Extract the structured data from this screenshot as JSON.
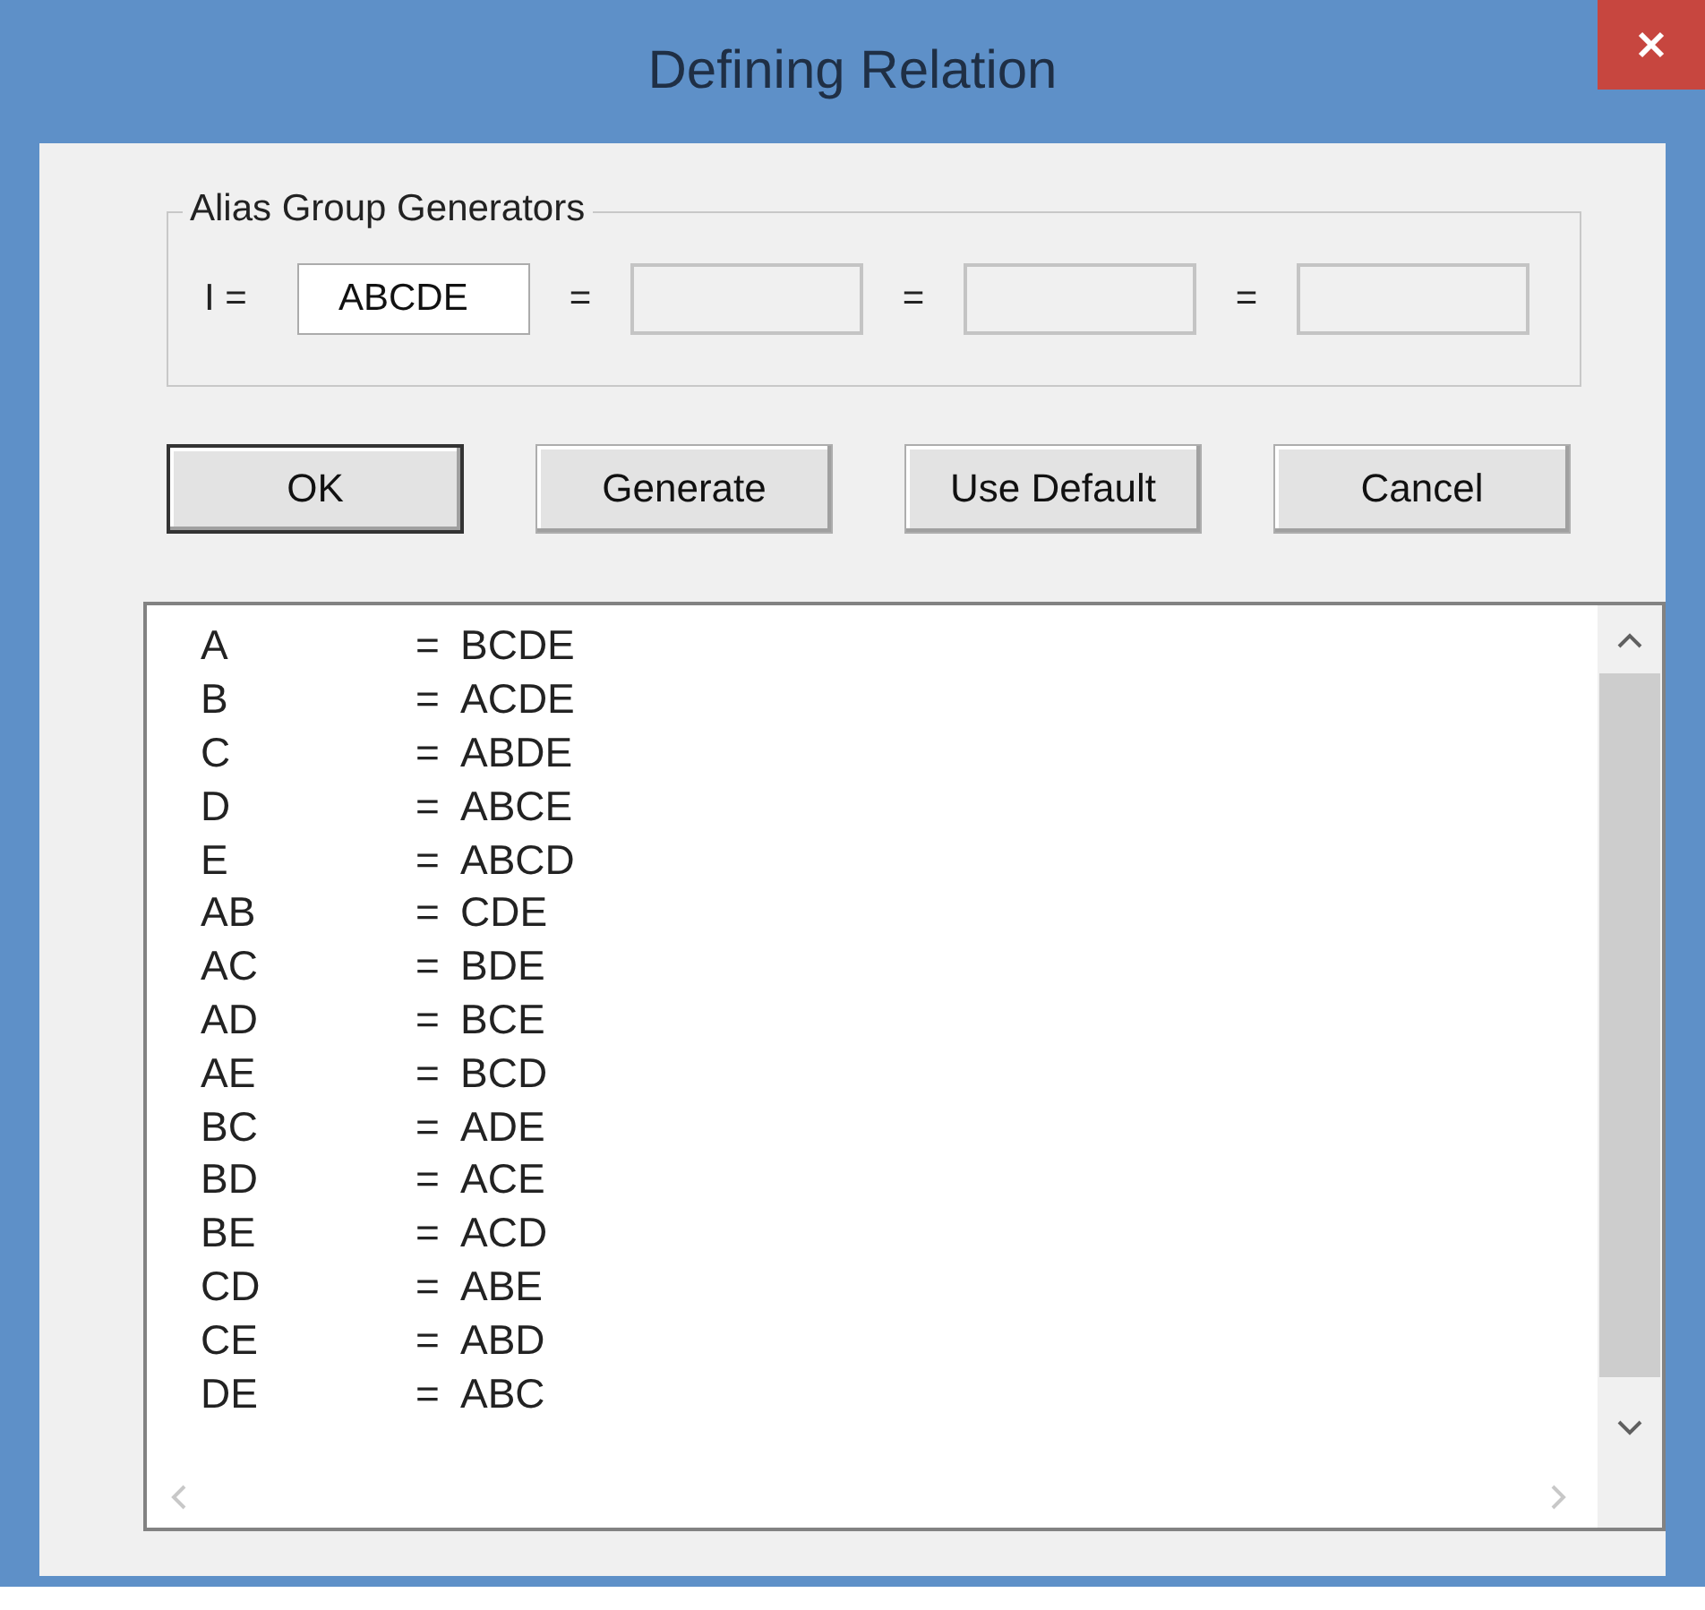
{
  "window": {
    "title": "Defining Relation"
  },
  "group": {
    "label": "Alias Group Generators",
    "fields": [
      {
        "prefix": "I =",
        "value": "ABCDE",
        "disabled": false
      },
      {
        "prefix": "=",
        "disabled": true
      },
      {
        "prefix": "=",
        "disabled": true
      },
      {
        "prefix": "=",
        "disabled": true
      }
    ]
  },
  "buttons": [
    {
      "label": "OK",
      "default": true
    },
    {
      "label": "Generate",
      "default": false
    },
    {
      "label": "Use Default",
      "default": false
    },
    {
      "label": "Cancel",
      "default": false
    }
  ],
  "list": {
    "rows": [
      {
        "term": "A",
        "eq": "=",
        "alias": "BCDE"
      },
      {
        "term": "B",
        "eq": "=",
        "alias": "ACDE"
      },
      {
        "term": "C",
        "eq": "=",
        "alias": "ABDE"
      },
      {
        "term": "D",
        "eq": "=",
        "alias": "ABCE"
      },
      {
        "term": "E",
        "eq": "=",
        "alias": "ABCD"
      },
      {
        "term": "AB",
        "eq": "=",
        "alias": "CDE"
      },
      {
        "term": "AC",
        "eq": "=",
        "alias": "BDE"
      },
      {
        "term": "AD",
        "eq": "=",
        "alias": "BCE"
      },
      {
        "term": "AE",
        "eq": "=",
        "alias": "BCD"
      },
      {
        "term": "BC",
        "eq": "=",
        "alias": "ADE"
      },
      {
        "term": "BD",
        "eq": "=",
        "alias": "ACE"
      },
      {
        "term": "BE",
        "eq": "=",
        "alias": "ACD"
      },
      {
        "term": "CD",
        "eq": "=",
        "alias": "ABE"
      },
      {
        "term": "CE",
        "eq": "=",
        "alias": "ABD"
      },
      {
        "term": "DE",
        "eq": "=",
        "alias": "ABC"
      }
    ]
  }
}
